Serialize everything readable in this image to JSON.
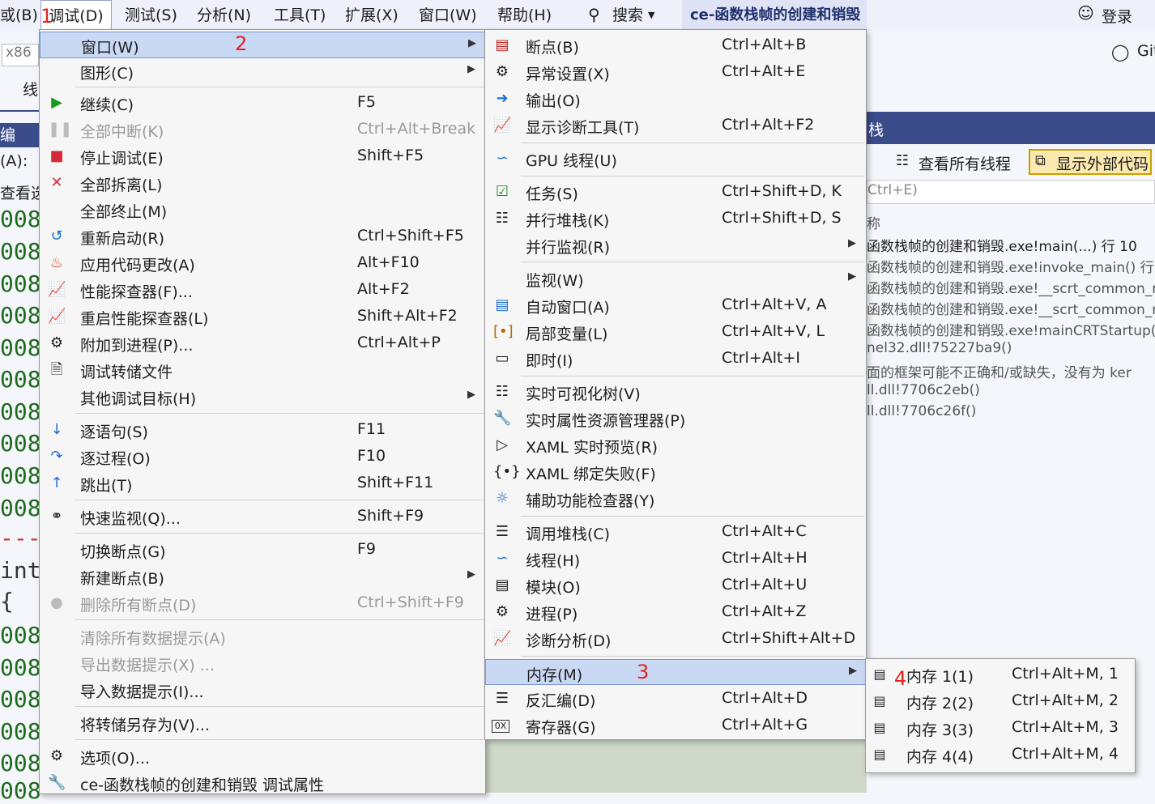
{
  "menubar": {
    "items": [
      {
        "label": "或(B)"
      },
      {
        "label": "调试(D)"
      },
      {
        "label": "测试(S)"
      },
      {
        "label": "分析(N)"
      },
      {
        "label": "工具(T)"
      },
      {
        "label": "扩展(X)"
      },
      {
        "label": "窗口(W)"
      },
      {
        "label": "帮助(H)"
      }
    ],
    "search_label": "搜索",
    "title": "ce-函数栈帧的创建和销毁",
    "login_label": "登录",
    "git_label": "Git"
  },
  "ide": {
    "platform": "x86",
    "left_fragments": [
      "线",
      "编",
      "(A):",
      "查看选"
    ],
    "code_lines": [
      "008",
      "008",
      "008",
      "008",
      "008",
      "008",
      "008",
      "008",
      "008",
      "008",
      "---",
      "int",
      "{",
      "008",
      "008",
      "008",
      "008",
      "008",
      "008"
    ],
    "right_header": "栈",
    "view_all_threads": "查看所有线程",
    "show_external_code": "显示外部代码",
    "search_hint": "Ctrl+E)",
    "name_col": "称",
    "stack_rows": [
      "函数栈帧的创建和销毁.exe!main(...) 行 10",
      "函数栈帧的创建和销毁.exe!invoke_main() 行",
      "函数栈帧的创建和销毁.exe!__scrt_common_r",
      "函数栈帧的创建和销毁.exe!__scrt_common_r",
      "函数栈帧的创建和销毁.exe!mainCRTStartup(v",
      "nel32.dll!75227ba9()",
      "面的框架可能不正确和/或缺失，没有为 ker",
      "ll.dll!7706c2eb()",
      "ll.dll!7706c26f()"
    ]
  },
  "debug_menu": {
    "items": [
      {
        "label": "窗口(W)",
        "shortcut": "",
        "submenu": true,
        "icon": ""
      },
      {
        "label": "图形(C)",
        "shortcut": "",
        "submenu": true,
        "icon": ""
      },
      {
        "label": "继续(C)",
        "shortcut": "F5",
        "icon": "play-icon"
      },
      {
        "label": "全部中断(K)",
        "shortcut": "Ctrl+Alt+Break",
        "icon": "pause-icon",
        "disabled": true
      },
      {
        "label": "停止调试(E)",
        "shortcut": "Shift+F5",
        "icon": "stop-icon"
      },
      {
        "label": "全部拆离(L)",
        "shortcut": "",
        "icon": "detach-icon"
      },
      {
        "label": "全部终止(M)",
        "shortcut": "",
        "icon": ""
      },
      {
        "label": "重新启动(R)",
        "shortcut": "Ctrl+Shift+F5",
        "icon": "restart-icon"
      },
      {
        "label": "应用代码更改(A)",
        "shortcut": "Alt+F10",
        "icon": "hot-reload-icon"
      },
      {
        "label": "性能探查器(F)...",
        "shortcut": "Alt+F2",
        "icon": "profiler-icon"
      },
      {
        "label": "重启性能探查器(L)",
        "shortcut": "Shift+Alt+F2",
        "icon": "profiler-restart-icon"
      },
      {
        "label": "附加到进程(P)...",
        "shortcut": "Ctrl+Alt+P",
        "icon": "attach-icon"
      },
      {
        "label": "调试转储文件",
        "shortcut": "",
        "icon": "dump-icon"
      },
      {
        "label": "其他调试目标(H)",
        "shortcut": "",
        "submenu": true,
        "icon": ""
      },
      {
        "label": "逐语句(S)",
        "shortcut": "F11",
        "icon": "step-into-icon"
      },
      {
        "label": "逐过程(O)",
        "shortcut": "F10",
        "icon": "step-over-icon"
      },
      {
        "label": "跳出(T)",
        "shortcut": "Shift+F11",
        "icon": "step-out-icon"
      },
      {
        "label": "快速监视(Q)...",
        "shortcut": "Shift+F9",
        "icon": "quickwatch-icon"
      },
      {
        "label": "切换断点(G)",
        "shortcut": "F9",
        "icon": ""
      },
      {
        "label": "新建断点(B)",
        "shortcut": "",
        "submenu": true,
        "icon": ""
      },
      {
        "label": "删除所有断点(D)",
        "shortcut": "Ctrl+Shift+F9",
        "icon": "delete-breakpoints-icon",
        "disabled": true
      },
      {
        "label": "清除所有数据提示(A)",
        "shortcut": "",
        "icon": "",
        "disabled": true
      },
      {
        "label": "导出数据提示(X) ...",
        "shortcut": "",
        "icon": "",
        "disabled": true
      },
      {
        "label": "导入数据提示(I)...",
        "shortcut": "",
        "icon": ""
      },
      {
        "label": "将转储另存为(V)...",
        "shortcut": "",
        "icon": ""
      },
      {
        "label": "选项(O)...",
        "shortcut": "",
        "icon": "gear-icon"
      },
      {
        "label": "ce-函数栈帧的创建和销毁 调试属性",
        "shortcut": "",
        "icon": "wrench-icon"
      }
    ]
  },
  "window_menu": {
    "items": [
      {
        "label": "断点(B)",
        "shortcut": "Ctrl+Alt+B",
        "icon": "breakpoints-window-icon"
      },
      {
        "label": "异常设置(X)",
        "shortcut": "Ctrl+Alt+E",
        "icon": "exception-settings-icon"
      },
      {
        "label": "输出(O)",
        "shortcut": "",
        "icon": "output-icon"
      },
      {
        "label": "显示诊断工具(T)",
        "shortcut": "Ctrl+Alt+F2",
        "icon": "diagnostic-tools-icon"
      },
      {
        "label": "GPU 线程(U)",
        "shortcut": "",
        "icon": "gpu-threads-icon"
      },
      {
        "label": "任务(S)",
        "shortcut": "Ctrl+Shift+D, K",
        "icon": "tasks-icon"
      },
      {
        "label": "并行堆栈(K)",
        "shortcut": "Ctrl+Shift+D, S",
        "icon": "parallel-stacks-icon"
      },
      {
        "label": "并行监视(R)",
        "shortcut": "",
        "submenu": true,
        "icon": ""
      },
      {
        "label": "监视(W)",
        "shortcut": "",
        "submenu": true,
        "icon": ""
      },
      {
        "label": "自动窗口(A)",
        "shortcut": "Ctrl+Alt+V, A",
        "icon": "autos-icon"
      },
      {
        "label": "局部变量(L)",
        "shortcut": "Ctrl+Alt+V, L",
        "icon": "locals-icon"
      },
      {
        "label": "即时(I)",
        "shortcut": "Ctrl+Alt+I",
        "icon": "immediate-icon"
      },
      {
        "label": "实时可视化树(V)",
        "shortcut": "",
        "icon": "visual-tree-icon"
      },
      {
        "label": "实时属性资源管理器(P)",
        "shortcut": "",
        "icon": "property-explorer-icon"
      },
      {
        "label": "XAML 实时预览(R)",
        "shortcut": "",
        "icon": "xaml-preview-icon"
      },
      {
        "label": "XAML 绑定失败(F)",
        "shortcut": "",
        "icon": "xaml-binding-icon"
      },
      {
        "label": "辅助功能检查器(Y)",
        "shortcut": "",
        "icon": "accessibility-icon"
      },
      {
        "label": "调用堆栈(C)",
        "shortcut": "Ctrl+Alt+C",
        "icon": "call-stack-icon"
      },
      {
        "label": "线程(H)",
        "shortcut": "Ctrl+Alt+H",
        "icon": "threads-icon"
      },
      {
        "label": "模块(O)",
        "shortcut": "Ctrl+Alt+U",
        "icon": "modules-icon"
      },
      {
        "label": "进程(P)",
        "shortcut": "Ctrl+Alt+Z",
        "icon": "processes-icon"
      },
      {
        "label": "诊断分析(D)",
        "shortcut": "Ctrl+Shift+Alt+D",
        "icon": "diagnostic-analysis-icon"
      },
      {
        "label": "内存(M)",
        "shortcut": "",
        "submenu": true,
        "icon": ""
      },
      {
        "label": "反汇编(D)",
        "shortcut": "Ctrl+Alt+D",
        "icon": "disassembly-icon"
      },
      {
        "label": "寄存器(G)",
        "shortcut": "Ctrl+Alt+G",
        "icon": "registers-icon"
      }
    ]
  },
  "memory_menu": {
    "items": [
      {
        "label": "内存 1(1)",
        "shortcut": "Ctrl+Alt+M, 1",
        "icon": "memory-icon"
      },
      {
        "label": "内存 2(2)",
        "shortcut": "Ctrl+Alt+M, 2",
        "icon": "memory-icon"
      },
      {
        "label": "内存 3(3)",
        "shortcut": "Ctrl+Alt+M, 3",
        "icon": "memory-icon"
      },
      {
        "label": "内存 4(4)",
        "shortcut": "Ctrl+Alt+M, 4",
        "icon": "memory-icon"
      }
    ]
  },
  "annotations": [
    "1",
    "2",
    "3",
    "4"
  ],
  "colors": {
    "highlight": "#c9d9f3",
    "annotation": "#e32222",
    "header": "#3b4c8a"
  }
}
